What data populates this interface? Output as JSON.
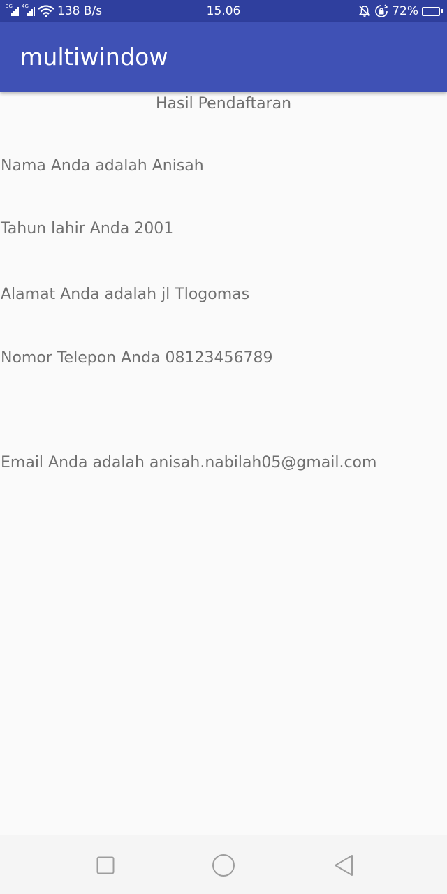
{
  "status_bar": {
    "network_1": "3G",
    "network_2": "4G",
    "data_speed": "138 B/s",
    "time": "15.06",
    "battery_percent": "72%",
    "battery_level": 0.72,
    "icons": [
      "signal-icon",
      "signal-icon",
      "wifi-icon",
      "mute-icon",
      "rotation-lock-icon",
      "battery-icon"
    ]
  },
  "app_bar": {
    "title": "multiwindow",
    "color": "#3f51b5"
  },
  "content": {
    "heading": "Hasil Pendaftaran",
    "name_line": "Nama Anda adalah Anisah",
    "birth_year_line": "Tahun lahir Anda 2001",
    "address_line": "Alamat Anda adalah jl Tlogomas",
    "phone_line": "Nomor Telepon Anda 08123456789",
    "email_line": "Email Anda adalah anisah.nabilah05@gmail.com"
  },
  "nav_bar": {
    "buttons": [
      "recents-icon",
      "home-icon",
      "back-icon"
    ]
  }
}
